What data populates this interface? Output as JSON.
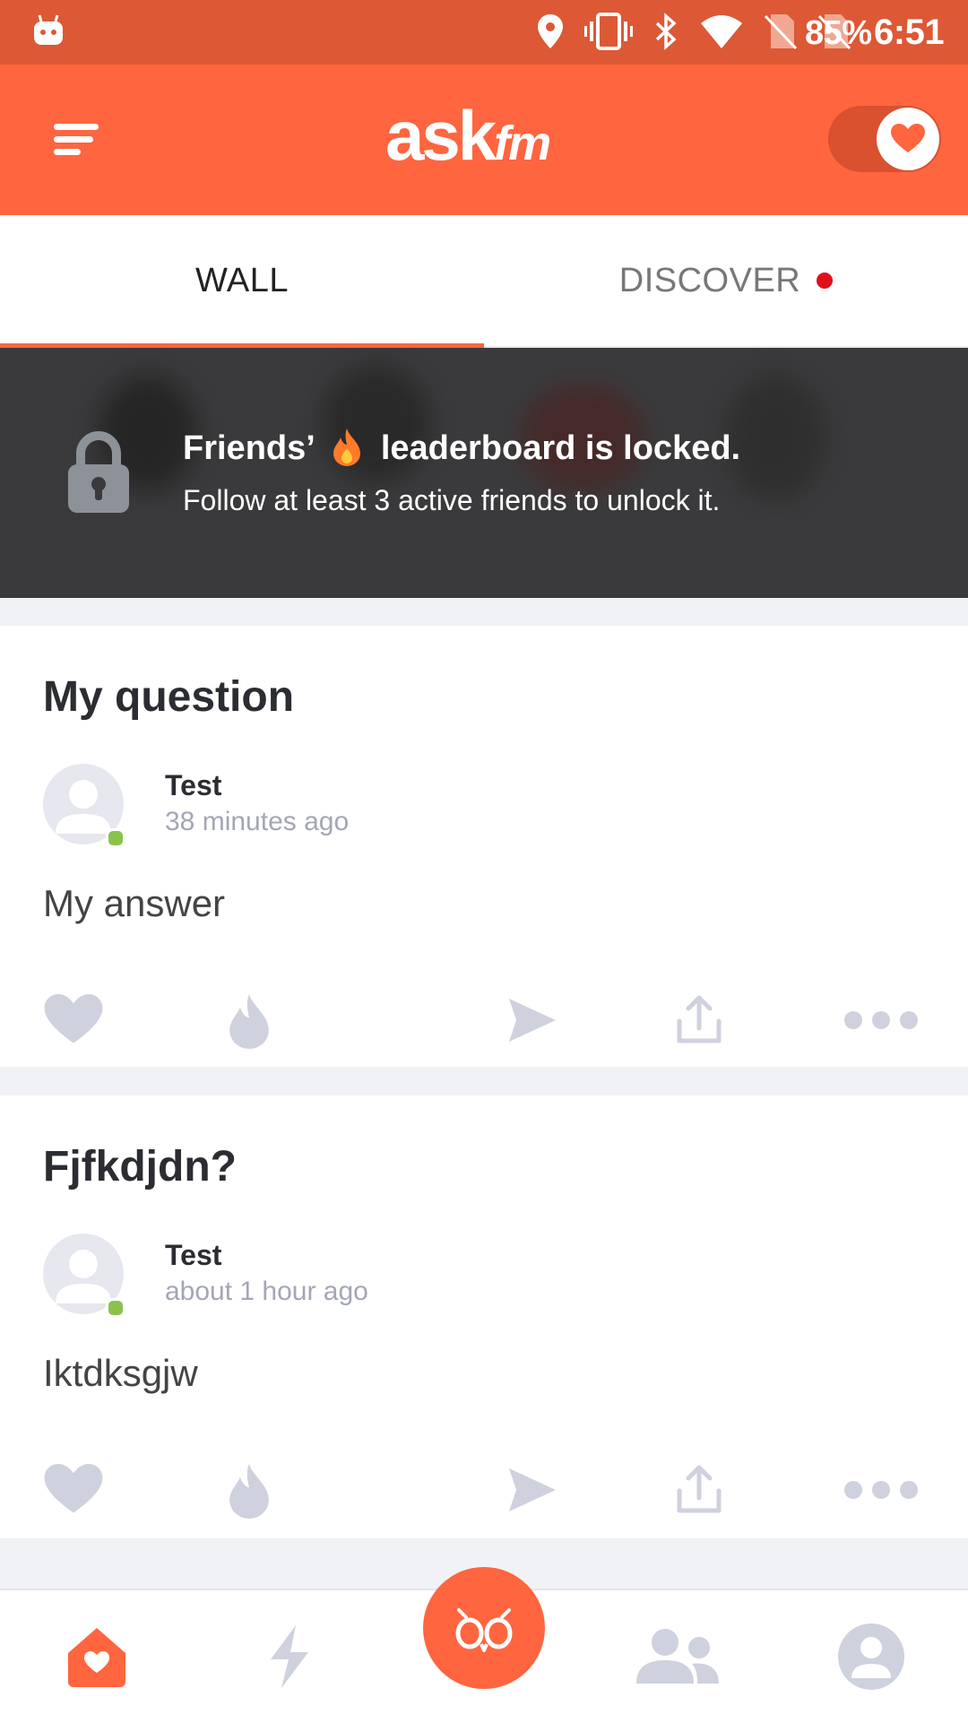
{
  "status": {
    "battery": "85%",
    "time": "6:51"
  },
  "header": {
    "logo_main": "ask",
    "logo_sub": "fm"
  },
  "tabs": [
    {
      "label": "WALL"
    },
    {
      "label": "DISCOVER"
    }
  ],
  "leaderboard": {
    "title_before": "Friends’",
    "title_after": "leaderboard is locked.",
    "subtitle": "Follow at least 3 active friends to unlock it."
  },
  "posts": [
    {
      "question": "My question",
      "user": "Test",
      "time": "38 minutes ago",
      "answer": "My answer"
    },
    {
      "question": "Fjfkdjdn?",
      "user": "Test",
      "time": "about 1 hour ago",
      "answer": "Iktdksgjw"
    }
  ],
  "colors": {
    "brand": "#ff653f",
    "statusbar": "#dd5835",
    "icon_gray": "#cfd1de",
    "notify_dot": "#e0101a",
    "online": "#8bc34a"
  }
}
